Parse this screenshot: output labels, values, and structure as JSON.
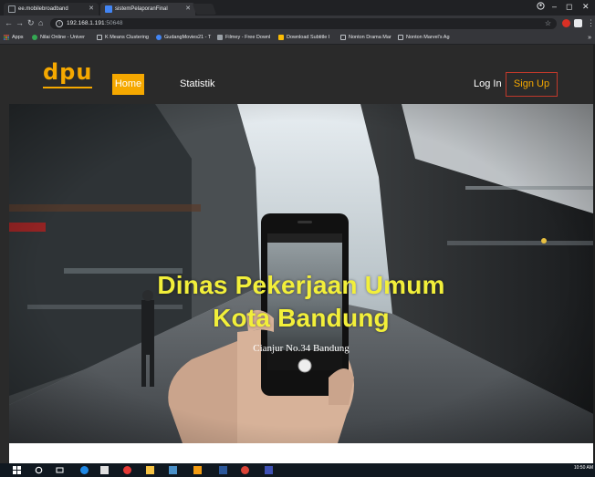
{
  "browser": {
    "tabs": [
      {
        "title": "ee.mobilebroadband",
        "active": false
      },
      {
        "title": "sistemPelaporanFinal",
        "active": true
      }
    ],
    "url": {
      "host": "192.168.1.191",
      "port": ":50648"
    },
    "info_glyph": "i",
    "window_controls": {
      "minimize": "–",
      "maximize": "◻",
      "close": "✕"
    },
    "bookmarks": [
      {
        "label": "Apps",
        "icon": "apps-grid-icon",
        "color": "#e8563f"
      },
      {
        "label": "Nilai Online - Univer",
        "icon": "bookmark-icon",
        "color": "#34a853"
      },
      {
        "label": "K Means Clustering",
        "icon": "page-icon",
        "color": "#bdc1c6"
      },
      {
        "label": "GudangMovies21 - T",
        "icon": "bookmark-icon",
        "color": "#4285f4"
      },
      {
        "label": "Filmey - Free Downl",
        "icon": "bookmark-icon",
        "color": "#9aa0a6"
      },
      {
        "label": "Download Subtitle I",
        "icon": "bookmark-icon",
        "color": "#fbbc04"
      },
      {
        "label": "Nonton Drama Mar",
        "icon": "page-icon",
        "color": "#bdc1c6"
      },
      {
        "label": "Nonton Marvel's Ag",
        "icon": "page-icon",
        "color": "#bdc1c6"
      }
    ],
    "bookmarks_more": "»",
    "account_icon": "account-icon"
  },
  "site": {
    "logo": "dpu",
    "nav": {
      "home": "Home",
      "statistik": "Statistik",
      "login": "Log In",
      "signup": "Sign Up"
    },
    "colors": {
      "accent": "#f5a800",
      "nav_bg": "#2a2a2a",
      "signup_border": "#c0392b",
      "hero_title": "#f2ef3a"
    },
    "hero": {
      "title_line1": "Dinas Pekerjaan Umum",
      "title_line2": "Kota Bandung",
      "address": "Cianjur No.34 Bandung"
    }
  },
  "taskbar": {
    "clock": "10:50 AM",
    "items": [
      "windows-start-icon",
      "search-icon",
      "task-view-icon",
      "edge-icon",
      "store-icon",
      "opera-icon",
      "file-explorer-icon",
      "photos-icon",
      "sublime-icon",
      "word-icon",
      "chrome-icon",
      "app-icon"
    ]
  }
}
